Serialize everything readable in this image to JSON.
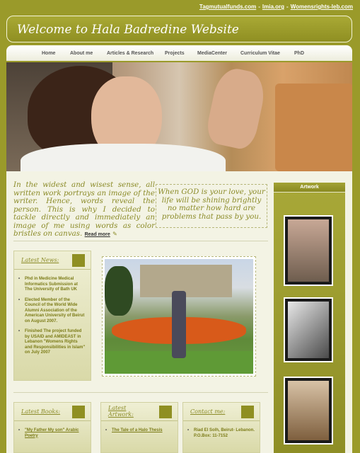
{
  "top_links": [
    "Tagmutualfunds.com",
    "lmia.org",
    "Womensrights-leb.com"
  ],
  "site_title": "Welcome to Hala Badredine Website",
  "nav": [
    "Home",
    "About me",
    "Articles & Research",
    "Projects",
    "MediaCenter",
    "Curriculum Vitae",
    "PhD"
  ],
  "intro": {
    "text": "In the widest and wisest sense, all written work portrays an image of the writer. Hence, words reveal the person. This is why I decided to tackle directly and immediately an image of me using words as color bristles on canvas.",
    "read_more": "Read more"
  },
  "quote": "When GOD is your love, your life will be shining brightly no matter how hard are problems that pass by you.",
  "artwork_heading": "Artwork",
  "latest_news": {
    "title": "Latest News:",
    "items": [
      "Phd in Medicine Medical Informatics Submission at The University of Bath UK",
      "Elected Member of the Council of the World Wide Alumni Association of the American University of Beirut on August 2007.",
      "Finished The project funded by USAID and AMIDEAST in Lebanon \"Womens Rights and Responsibilities in Islam\" on July 2007"
    ]
  },
  "latest_books": {
    "title": "Latest Books:",
    "items": [
      "\"My Father My son\" Arabic Poetry"
    ]
  },
  "latest_artwork": {
    "title": "Latest Artwork:",
    "items": [
      "The Tale of a Halo Thesis"
    ]
  },
  "contact": {
    "title": "Contact me:",
    "items": [
      "Riad El Solh, Beirut- Lebanon. P.O.Box: 11-7152"
    ]
  },
  "colors": {
    "olive": "#9a9a2a",
    "olive_dark": "#8f8f22",
    "text_olive": "#8b8b28",
    "cream": "#f3f3e4"
  }
}
